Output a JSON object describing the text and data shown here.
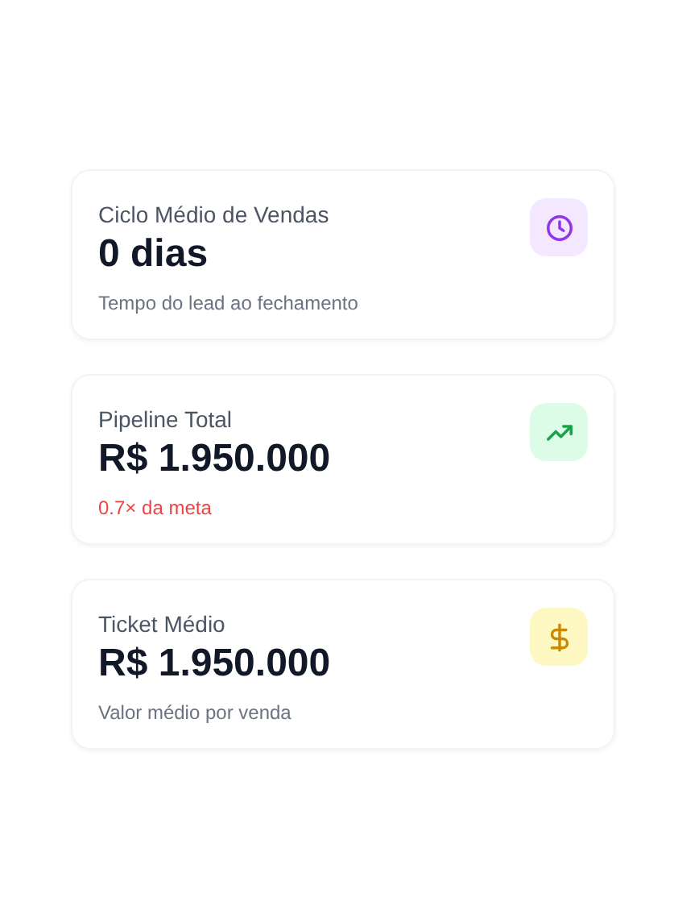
{
  "cards": [
    {
      "kind": "clock",
      "title": "Ciclo Médio de Vendas",
      "value": "0 dias",
      "note": "Tempo do lead ao fechamento",
      "color": "#6b7280"
    },
    {
      "kind": "trend",
      "title": "Pipeline Total",
      "value": "R$ 1.950.000",
      "note": "0.7× da meta",
      "color": "#ef4444"
    },
    {
      "kind": "dollar",
      "title": "Ticket Médio",
      "value": "R$ 1.950.000",
      "note": "Valor médio por venda",
      "color": "#6b7280"
    }
  ]
}
